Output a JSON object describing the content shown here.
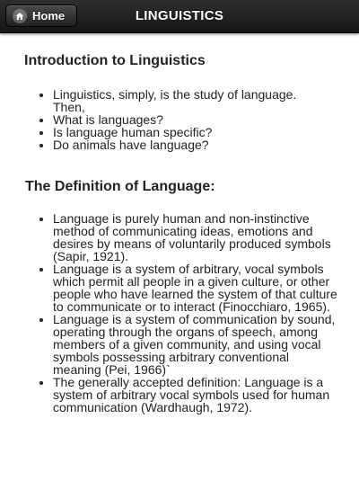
{
  "header": {
    "home_label": "Home",
    "title": "LINGUISTICS"
  },
  "sections": [
    {
      "heading": "Introduction to Linguistics",
      "items": [
        "Linguistics, simply, is the study of language. Then,",
        "What is languages?",
        "Is language human specific?",
        "Do animals have language?"
      ]
    },
    {
      "heading": "The Definition of Language:",
      "items": [
        "Language is purely human and non-instinctive method of communicating ideas, emotions and desires by means of voluntarily produced symbols (Sapir, 1921).",
        "Language is a system of arbitrary, vocal symbols which permit all people in a given culture, or other people who have learned the system of that culture to communicate or to interact (Finocchiaro, 1965).",
        "Language is a system of communication by sound, operating through the organs of speech, among members of a given community, and using vocal symbols possessing arbitrary conventional meaning (Pei, 1966)`",
        "The generally accepted definition: Language is a system of arbitrary vocal symbols used for human communication (Wardhaugh, 1972)."
      ]
    }
  ]
}
